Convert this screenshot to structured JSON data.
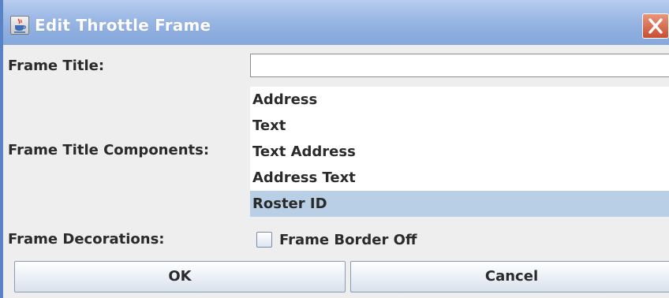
{
  "dialog": {
    "title": "Edit Throttle Frame",
    "accent_color": "#8eaedf",
    "icon": "java-cup-icon",
    "close_icon": "close-icon"
  },
  "form": {
    "frame_title_label": "Frame Title:",
    "frame_title_value": "",
    "components_label": "Frame Title Components:",
    "components_options": [
      "Address",
      "Text",
      "Text Address",
      "Address Text",
      "Roster ID"
    ],
    "components_selected": "Roster ID",
    "selection_color": "#b8cfe5",
    "decorations_label": "Frame Decorations:",
    "border_off_label": "Frame Border Off",
    "border_off_checked": false
  },
  "buttons": {
    "ok": "OK",
    "cancel": "Cancel"
  }
}
